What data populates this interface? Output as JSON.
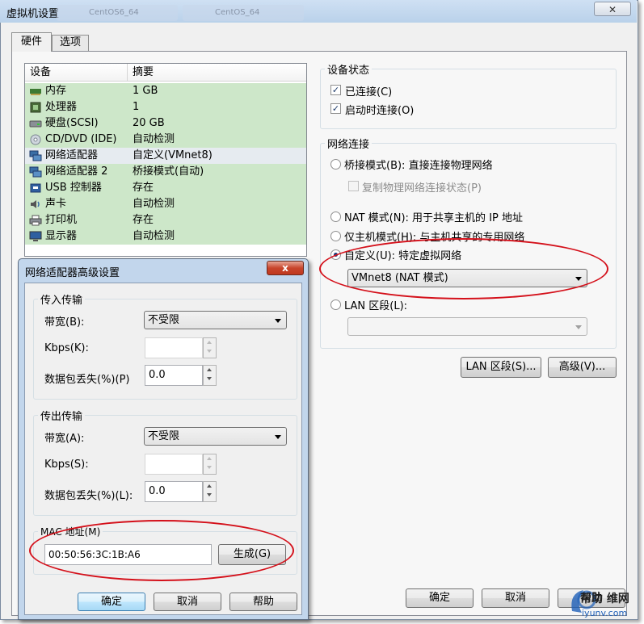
{
  "window": {
    "title": "虚拟机设置",
    "bg_tab_1": "CentOS6_64",
    "bg_tab_2": "CentOS_64",
    "close": "✕"
  },
  "tabs": [
    {
      "label": "硬件"
    },
    {
      "label": "选项"
    }
  ],
  "devices": {
    "col_device": "设备",
    "col_summary": "摘要",
    "rows": [
      {
        "name": "内存",
        "summary": "1 GB",
        "icon": "memory-icon"
      },
      {
        "name": "处理器",
        "summary": "1",
        "icon": "processor-icon"
      },
      {
        "name": "硬盘(SCSI)",
        "summary": "20 GB",
        "icon": "harddisk-icon"
      },
      {
        "name": "CD/DVD (IDE)",
        "summary": "自动检测",
        "icon": "cd-dvd-icon"
      },
      {
        "name": "网络适配器",
        "summary": "自定义(VMnet8)",
        "icon": "network-adapter-icon"
      },
      {
        "name": "网络适配器 2",
        "summary": "桥接模式(自动)",
        "icon": "network-adapter-icon"
      },
      {
        "name": "USB 控制器",
        "summary": "存在",
        "icon": "usb-icon"
      },
      {
        "name": "声卡",
        "summary": "自动检测",
        "icon": "sound-card-icon"
      },
      {
        "name": "打印机",
        "summary": "存在",
        "icon": "printer-icon"
      },
      {
        "name": "显示器",
        "summary": "自动检测",
        "icon": "display-icon"
      }
    ]
  },
  "device_status": {
    "title": "设备状态",
    "connected": "已连接(C)",
    "connect_at_power_on": "启动时连接(O)"
  },
  "network": {
    "title": "网络连接",
    "bridged": "桥接模式(B): 直接连接物理网络",
    "replicate": "复制物理网络连接状态(P)",
    "nat": "NAT 模式(N): 用于共享主机的 IP 地址",
    "host_only": "仅主机模式(H): 与主机共享的专用网络",
    "custom": "自定义(U): 特定虚拟网络",
    "custom_value": "VMnet8 (NAT 模式)",
    "lan_segment": "LAN 区段(L):",
    "lan_value": "",
    "selected": "custom"
  },
  "buttons": {
    "lan_segments": "LAN 区段(S)...",
    "advanced": "高级(V)...",
    "ok": "确定",
    "cancel": "取消",
    "help": "帮助"
  },
  "advanced_dialog": {
    "title": "网络适配器高级设置",
    "close": "x",
    "incoming": {
      "title": "传入传输",
      "bandwidth_label": "带宽(B):",
      "bandwidth_value": "不受限",
      "kbps_label": "Kbps(K):",
      "kbps_value": "",
      "loss_label": "数据包丢失(%)(P)",
      "loss_value": "0.0"
    },
    "outgoing": {
      "title": "传出传输",
      "bandwidth_label": "带宽(A):",
      "bandwidth_value": "不受限",
      "kbps_label": "Kbps(S):",
      "kbps_value": "",
      "loss_label": "数据包丢失(%)(L):",
      "loss_value": "0.0"
    },
    "mac_label": "MAC 地址(M)",
    "mac_value": "00:50:56:3C:1B:A6",
    "generate": "生成(G)",
    "ok": "确定",
    "cancel": "取消",
    "help": "帮助"
  },
  "watermark": {
    "line1": "帮助 维网",
    "line2": "iyunv.com"
  },
  "annotation_color": "#d4101a"
}
